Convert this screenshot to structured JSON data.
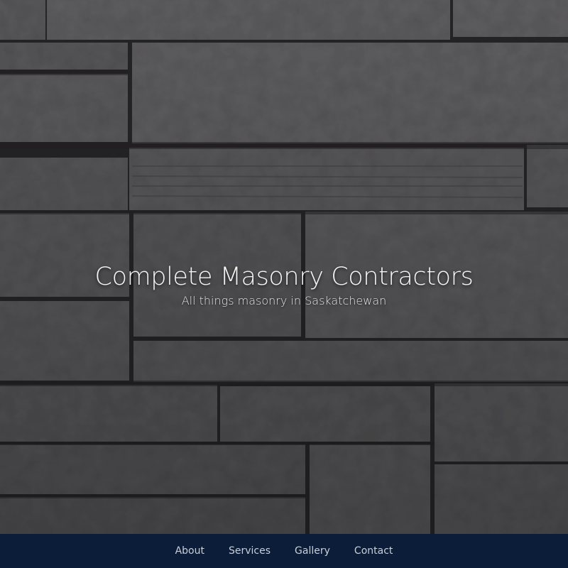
{
  "hero": {
    "title": "Complete Masonry Contractors",
    "subtitle": "All things masonry in Saskatchewan",
    "background": "stone-wall-image"
  },
  "nav": {
    "items": [
      {
        "label": "About"
      },
      {
        "label": "Services"
      },
      {
        "label": "Gallery"
      },
      {
        "label": "Contact"
      }
    ]
  },
  "colors": {
    "nav_background": "#0b1d38",
    "nav_text": "#c9cfd9",
    "title_text": "#f4f4f4"
  }
}
